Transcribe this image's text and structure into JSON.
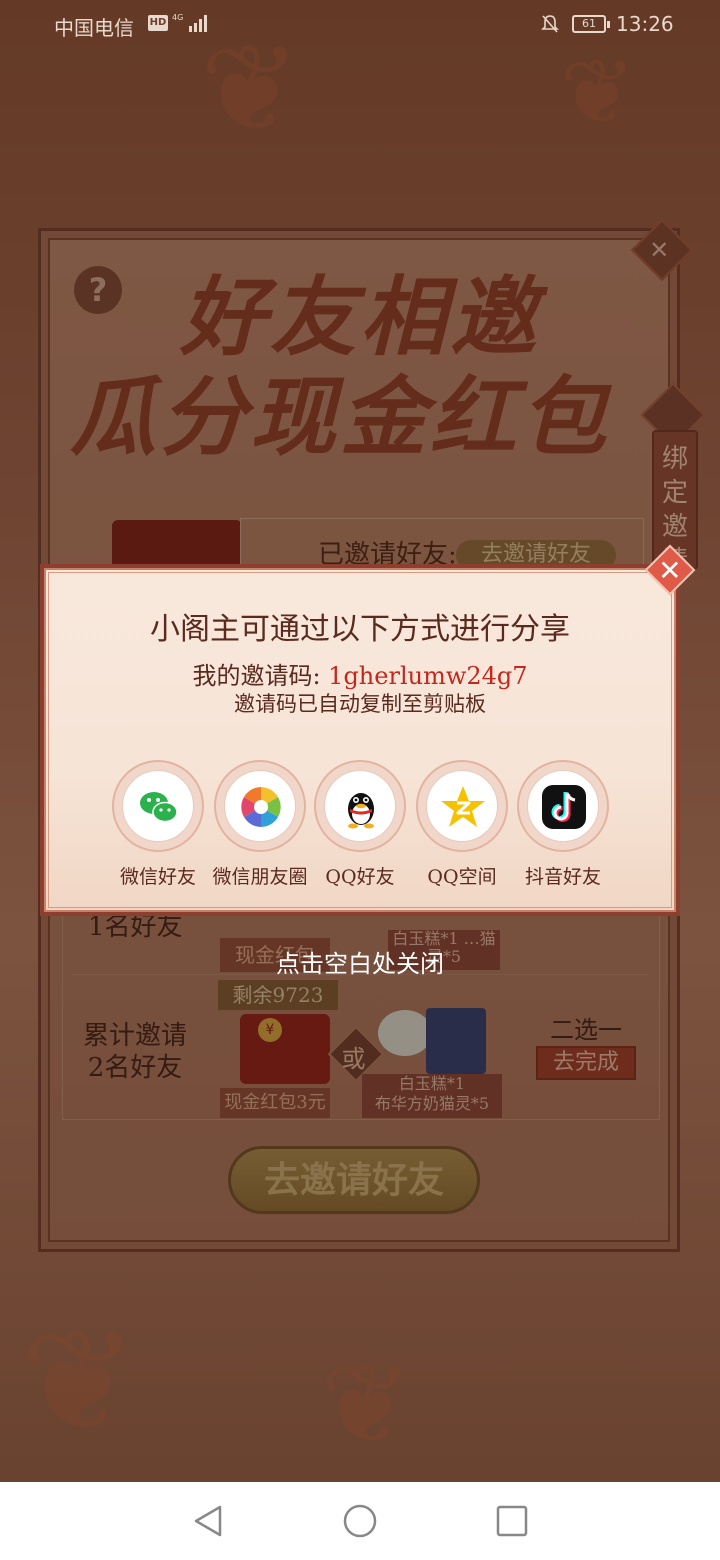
{
  "status_bar": {
    "carrier": "中国电信",
    "hd": "HD",
    "network": "4G",
    "battery": "61",
    "time": "13:26"
  },
  "background_page": {
    "help_symbol": "?",
    "close_symbol": "✕",
    "title_line1": "好友相邀",
    "title_line2": "瓜分现金红包",
    "bind_tag": "绑定邀请",
    "invited_label": "已邀请好友:",
    "invited_button": "去邀请好友",
    "task1_label": "1名好友",
    "task1_cash": "现金红包",
    "task1_reward": "白玉糕*1 …猫灵*5",
    "remain": "剩余9723",
    "task2_label": "累计邀请 2名好友",
    "task2_coin": "¥",
    "or_label": "或",
    "task2_cash": "现金红包3元",
    "task2_reward_line1": "白玉糕*1",
    "task2_reward_line2": "布华方奶猫灵*5",
    "choice_text": "二选一",
    "complete_button": "去完成",
    "invite_button": "去邀请好友"
  },
  "share_dialog": {
    "close_symbol": "✕",
    "title": "小阁主可通过以下方式进行分享",
    "invite_code_label": "我的邀请码: ",
    "invite_code": "1gherlumw24g7",
    "copied_note": "邀请码已自动复制至剪贴板",
    "options": [
      {
        "label": "微信好友",
        "icon": "wechat-icon"
      },
      {
        "label": "微信朋友圈",
        "icon": "wechat-moments-icon"
      },
      {
        "label": "QQ好友",
        "icon": "qq-icon"
      },
      {
        "label": "QQ空间",
        "icon": "qzone-icon"
      },
      {
        "label": "抖音好友",
        "icon": "douyin-icon"
      }
    ]
  },
  "tap_to_close": "点击空白处关闭",
  "nav_bar": {
    "back": "back-icon",
    "home": "home-icon",
    "recent": "recent-apps-icon"
  }
}
